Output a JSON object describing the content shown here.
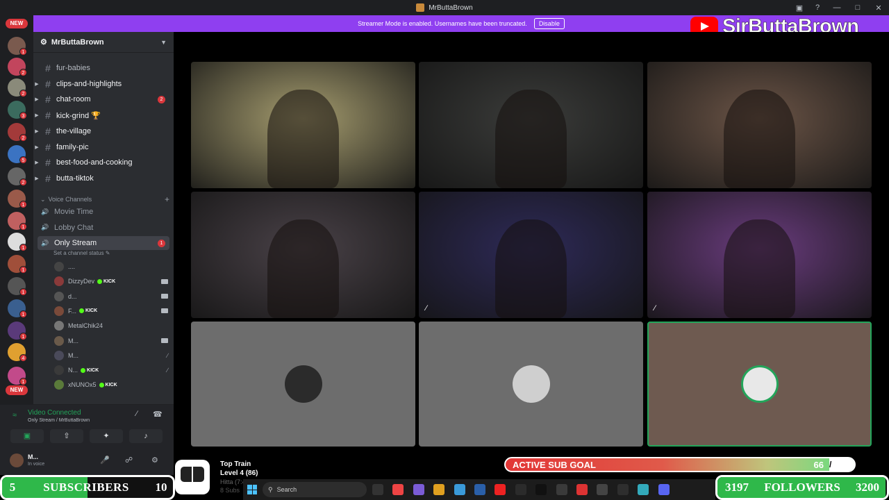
{
  "window": {
    "title": "MrButtaBrown",
    "controls": [
      "—",
      "□",
      "✕"
    ]
  },
  "banner": {
    "text": "Streamer Mode is enabled. Usernames have been truncated.",
    "button": "Disable"
  },
  "youtube": {
    "channel": "SirButtaBrown"
  },
  "rail": {
    "new_top": "NEW",
    "new_bottom": "NEW",
    "servers": [
      {
        "color": "#7a5a4e",
        "badge": "1"
      },
      {
        "color": "#c2455d",
        "badge": "2"
      },
      {
        "color": "#8a8a7a",
        "badge": "2"
      },
      {
        "color": "#3b6b5e",
        "badge": "3"
      },
      {
        "color": "#a33a3a",
        "badge": "2"
      },
      {
        "color": "#3b73c2",
        "badge": "5"
      },
      {
        "color": "#666666",
        "badge": "2"
      },
      {
        "color": "#9a5a4a",
        "badge": "1"
      },
      {
        "color": "#c06060",
        "badge": "1"
      },
      {
        "color": "#dddddd",
        "badge": "1"
      },
      {
        "color": "#a04f3a",
        "badge": "1"
      },
      {
        "color": "#555555",
        "badge": "1"
      },
      {
        "color": "#3a5f8f",
        "badge": "1"
      },
      {
        "color": "#5a3a7a",
        "badge": "1"
      },
      {
        "color": "#e0a030",
        "badge": "4"
      },
      {
        "color": "#c24a8a",
        "badge": "1"
      }
    ]
  },
  "server": {
    "name": "MrButtaBrown"
  },
  "channels": [
    {
      "name": "fur-babies",
      "badge": "",
      "arrow": false,
      "muted": true
    },
    {
      "name": "clips-and-highlights",
      "badge": "",
      "arrow": true,
      "muted": false
    },
    {
      "name": "chat-room",
      "badge": "2",
      "arrow": true,
      "muted": false
    },
    {
      "name": "kick-grind 🏆",
      "badge": "",
      "arrow": true,
      "muted": false
    },
    {
      "name": "the-village",
      "badge": "",
      "arrow": true,
      "muted": false
    },
    {
      "name": "family-pic",
      "badge": "",
      "arrow": true,
      "muted": false
    },
    {
      "name": "best-food-and-cooking",
      "badge": "",
      "arrow": true,
      "muted": false
    },
    {
      "name": "butta-tiktok",
      "badge": "",
      "arrow": true,
      "muted": false
    }
  ],
  "voice_category": "Voice Channels",
  "voice_channels": [
    {
      "name": "Movie Time",
      "active": false,
      "badge": ""
    },
    {
      "name": "Lobby Chat",
      "active": false,
      "badge": ""
    },
    {
      "name": "Only Stream",
      "active": true,
      "badge": "1"
    }
  ],
  "channel_status": "Set a channel status",
  "members": [
    {
      "name": "....",
      "kick": "",
      "icon": "none",
      "color": "#444444"
    },
    {
      "name": "DizzyDev",
      "kick": "KICK",
      "icon": "cam",
      "color": "#8a3a3a"
    },
    {
      "name": "d...",
      "kick": "",
      "icon": "cam",
      "color": "#555555"
    },
    {
      "name": "F...",
      "kick": "KICK",
      "icon": "cam",
      "color": "#7a4a3a"
    },
    {
      "name": "MetalChik24",
      "kick": "",
      "icon": "none",
      "color": "#777777"
    },
    {
      "name": "M...",
      "kick": "",
      "icon": "cam",
      "color": "#6a5a4a"
    },
    {
      "name": "M...",
      "kick": "",
      "icon": "off",
      "color": "#4a4a5a"
    },
    {
      "name": "N...",
      "kick": "KICK",
      "icon": "off",
      "color": "#3a3a3a"
    },
    {
      "name": "xNUNOx5",
      "kick": "KICK",
      "icon": "none",
      "color": "#5a7a3a"
    }
  ],
  "voice_panel": {
    "status": "Video Connected",
    "location": "Only Stream / MrButtaBrown"
  },
  "user_panel": {
    "name": "M...",
    "status": "In voice"
  },
  "tiles": [
    {
      "kind": "video",
      "bg": "#a69d6f"
    },
    {
      "kind": "video",
      "bg": "#3b3c3a"
    },
    {
      "kind": "video",
      "bg": "#6c5547"
    },
    {
      "kind": "video",
      "bg": "#4a4248"
    },
    {
      "kind": "video",
      "bg": "#2e2a58"
    },
    {
      "kind": "video",
      "bg": "#6a3c7e",
      "muted": true
    },
    {
      "kind": "avatar",
      "bg": "#6d6d6d",
      "avatar": "#2b2b2b"
    },
    {
      "kind": "avatar",
      "bg": "#6d6d6d",
      "avatar": "#cfcfcf"
    },
    {
      "kind": "avatar",
      "bg": "#6e5a50",
      "avatar": "#e8e8e8",
      "speaking": true
    }
  ],
  "top_train": {
    "title": "Top Train",
    "level": "Level 4  (86)",
    "faint1": "Hitta (7:4",
    "faint2": "8 Subs"
  },
  "sub_goal": {
    "label": "ACTIVE SUB GOAL",
    "current": "66",
    "target": "71",
    "progress": 0.93
  },
  "subscribers": {
    "current": "5",
    "label": "SUBSCRIBERS",
    "goal": "10",
    "progress": 0.5
  },
  "followers": {
    "current": "3197",
    "label": "FOLLOWERS",
    "goal": "3200",
    "progress": 0.99
  },
  "taskbar": {
    "search": "Search"
  },
  "colors": {
    "accent": "#8f3ff0",
    "danger": "#da373c",
    "online": "#23a55a",
    "kick": "#53fc18"
  }
}
